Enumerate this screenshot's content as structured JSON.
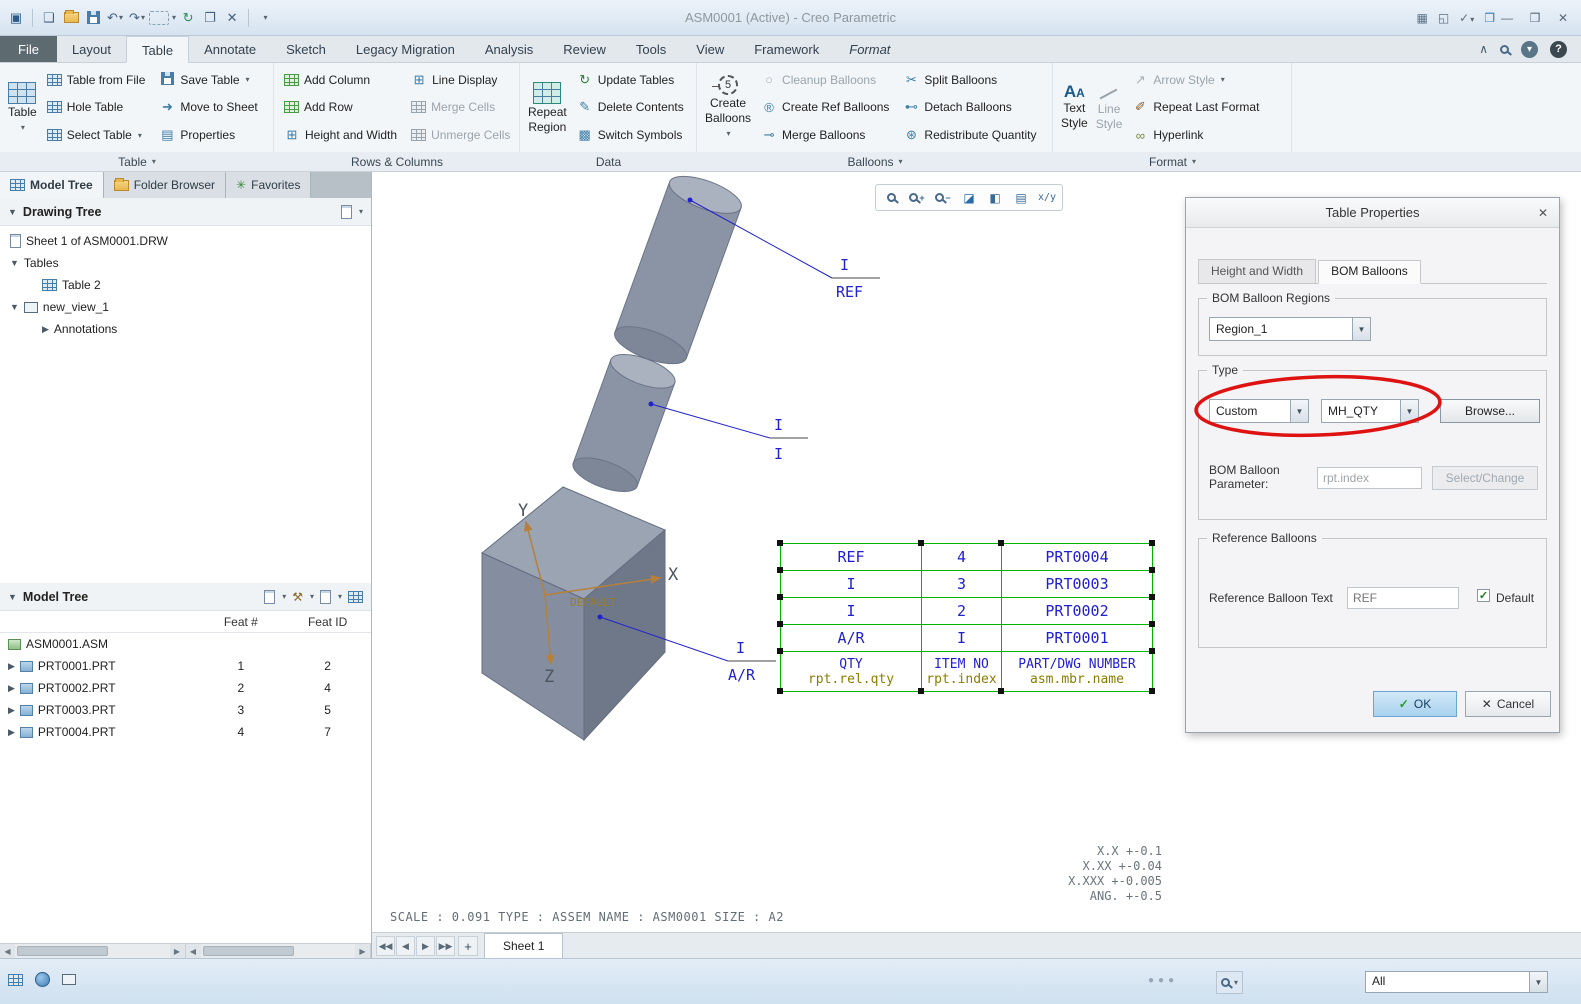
{
  "window": {
    "title": "ASM0001 (Active) - Creo Parametric"
  },
  "tabs": [
    "File",
    "Layout",
    "Table",
    "Annotate",
    "Sketch",
    "Legacy Migration",
    "Analysis",
    "Review",
    "Tools",
    "View",
    "Framework",
    "Format"
  ],
  "ribbon": {
    "group_labels": [
      "Table",
      "Rows & Columns",
      "Data",
      "Balloons",
      "Format"
    ],
    "table": {
      "big_label": "Table",
      "items": [
        "Table from File",
        "Hole Table",
        "Select Table",
        "Save Table",
        "Move to Sheet",
        "Properties"
      ]
    },
    "rows_columns": {
      "items": [
        "Add Column",
        "Add Row",
        "Height and Width",
        "Line Display",
        "Merge Cells",
        "Unmerge Cells"
      ]
    },
    "data": {
      "big_line1": "Repeat",
      "big_line2": "Region",
      "items": [
        "Update Tables",
        "Delete Contents",
        "Switch Symbols"
      ]
    },
    "balloons": {
      "big_line1": "Create",
      "big_line2": "Balloons",
      "items": [
        "Cleanup Balloons",
        "Create Ref Balloons",
        "Merge Balloons",
        "Split Balloons",
        "Detach Balloons",
        "Redistribute Quantity"
      ]
    },
    "format": {
      "big1_line1": "Text",
      "big1_line2": "Style",
      "big2_line1": "Line",
      "big2_line2": "Style",
      "items": [
        "Arrow Style",
        "Repeat Last Format",
        "Hyperlink"
      ]
    }
  },
  "left_panel": {
    "tabs": [
      "Model Tree",
      "Folder Browser",
      "Favorites"
    ],
    "drawing_tree": {
      "header": "Drawing Tree",
      "items": {
        "sheet": "Sheet 1 of ASM0001.DRW",
        "tables": "Tables",
        "table2": "Table 2",
        "view": "new_view_1",
        "annotations": "Annotations"
      }
    },
    "model_tree": {
      "header": "Model Tree",
      "col1": "Feat #",
      "col2": "Feat ID",
      "root": "ASM0001.ASM",
      "rows": [
        {
          "name": "PRT0001.PRT",
          "feat": "1",
          "id": "2"
        },
        {
          "name": "PRT0002.PRT",
          "feat": "2",
          "id": "4"
        },
        {
          "name": "PRT0003.PRT",
          "feat": "3",
          "id": "5"
        },
        {
          "name": "PRT0004.PRT",
          "feat": "4",
          "id": "7"
        }
      ]
    }
  },
  "canvas": {
    "leaders": [
      {
        "upper": "I",
        "lower": "REF"
      },
      {
        "upper": "I",
        "lower": "I"
      },
      {
        "upper": "I",
        "lower": "A/R"
      }
    ],
    "axes": {
      "x": "X",
      "y": "Y",
      "z": "Z",
      "datum": "DEFAULT"
    },
    "bom_table": {
      "rows": [
        {
          "qty": "REF",
          "item": "4",
          "part": "PRT0004"
        },
        {
          "qty": "I",
          "item": "3",
          "part": "PRT0003"
        },
        {
          "qty": "I",
          "item": "2",
          "part": "PRT0002"
        },
        {
          "qty": "A/R",
          "item": "I",
          "part": "PRT0001"
        }
      ],
      "header": {
        "qty_title": "QTY",
        "qty_param": "rpt.rel.qty",
        "item_title": "ITEM NO",
        "item_param": "rpt.index",
        "part_title": "PART/DWG NUMBER",
        "part_param": "asm.mbr.name"
      }
    },
    "note_line": "SCALE : 0.091    TYPE : ASSEM    NAME : ASM0001    SIZE : A2",
    "tolerances": [
      "X.X  +-0.1",
      "X.XX  +-0.04",
      "X.XXX +-0.005",
      "ANG. +-0.5"
    ],
    "sheet_tab": "Sheet 1"
  },
  "dialog": {
    "title": "Table Properties",
    "tabs": [
      "Height and Width",
      "BOM Balloons"
    ],
    "regions_legend": "BOM Balloon Regions",
    "region_value": "Region_1",
    "type_legend": "Type",
    "type_value": "Custom",
    "qty_type_value": "MH_QTY",
    "browse_label": "Browse...",
    "param_label_line1": "BOM Balloon",
    "param_label_line2": "Parameter:",
    "param_value": "rpt.index",
    "select_change_label": "Select/Change",
    "ref_legend": "Reference Balloons",
    "ref_text_label": "Reference Balloon Text",
    "ref_text_value": "REF",
    "default_label": "Default",
    "ok_label": "OK",
    "cancel_label": "Cancel"
  },
  "statusbar": {
    "filter_value": "All"
  }
}
